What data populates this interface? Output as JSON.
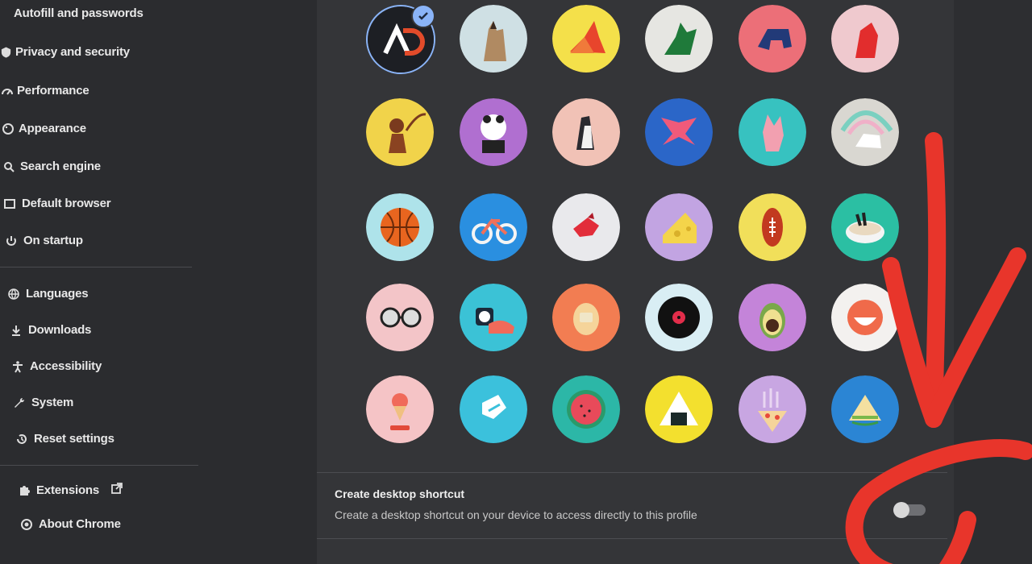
{
  "sidebar": {
    "items": [
      {
        "label": "Autofill and passwords",
        "icon": "key-icon"
      },
      {
        "label": "Privacy and security",
        "icon": "shield-icon"
      },
      {
        "label": "Performance",
        "icon": "speedometer-icon"
      },
      {
        "label": "Appearance",
        "icon": "palette-icon"
      },
      {
        "label": "Search engine",
        "icon": "search-icon"
      },
      {
        "label": "Default browser",
        "icon": "browser-icon"
      },
      {
        "label": "On startup",
        "icon": "power-icon"
      },
      {
        "label": "Languages",
        "icon": "globe-icon"
      },
      {
        "label": "Downloads",
        "icon": "download-icon"
      },
      {
        "label": "Accessibility",
        "icon": "accessibility-icon"
      },
      {
        "label": "System",
        "icon": "wrench-icon"
      },
      {
        "label": "Reset settings",
        "icon": "history-icon"
      },
      {
        "label": "Extensions",
        "icon": "puzzle-icon"
      },
      {
        "label": "About Chrome",
        "icon": "chrome-icon"
      }
    ]
  },
  "avatars": [
    [
      "ad-logo",
      "cat",
      "fox",
      "dragon",
      "elephant",
      "origami-fox"
    ],
    [
      "monkey",
      "panda",
      "penguin",
      "butterfly",
      "rabbit",
      "unicorn"
    ],
    [
      "basketball",
      "bicycle",
      "bird",
      "cheese",
      "football",
      "ramen"
    ],
    [
      "sunglasses",
      "sushi",
      "tamagotchi",
      "vinyl",
      "avocado",
      "smile"
    ],
    [
      "ice-cream",
      "onigiri-block",
      "watermelon",
      "onigiri",
      "pizza",
      "sandwich"
    ]
  ],
  "avatar_logo_text": "AD",
  "shortcut": {
    "title": "Create desktop shortcut",
    "description": "Create a desktop shortcut on your device to access directly to this profile",
    "enabled": false
  },
  "colors": {
    "accent": "#8ab4f8",
    "annotation": "#e8352b"
  }
}
